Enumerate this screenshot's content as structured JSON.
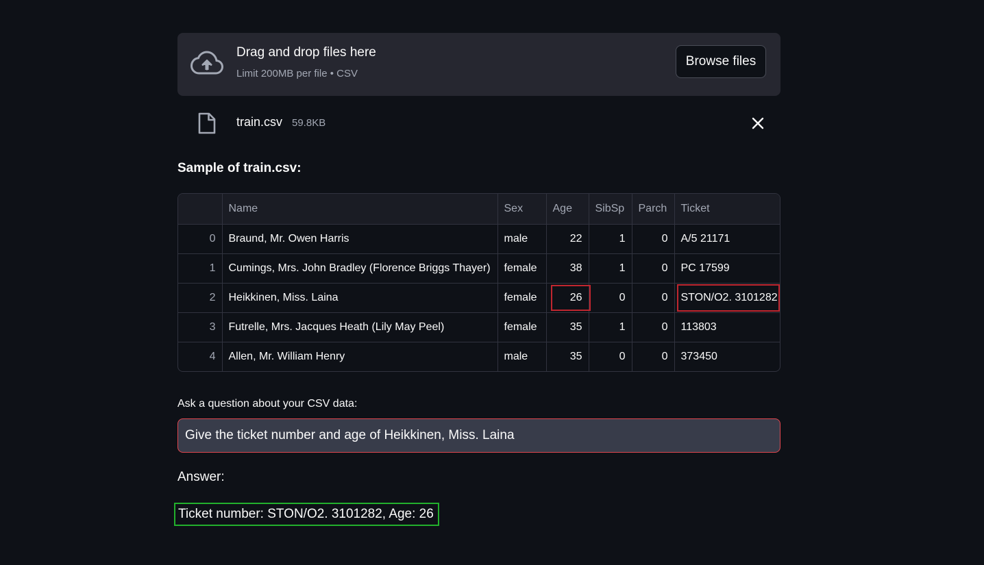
{
  "uploader": {
    "title": "Drag and drop files here",
    "subtitle": "Limit 200MB per file • CSV",
    "browse_label": "Browse files",
    "icon": "cloud-upload-icon"
  },
  "file": {
    "name": "train.csv",
    "size": "59.8KB",
    "icon": "file-icon",
    "remove_icon": "close-icon"
  },
  "sample": {
    "heading": "Sample of train.csv:",
    "columns": [
      "",
      "Name",
      "Sex",
      "Age",
      "SibSp",
      "Parch",
      "Ticket"
    ],
    "rows": [
      [
        "0",
        "Braund, Mr. Owen Harris",
        "male",
        "22",
        "1",
        "0",
        "A/5 21171"
      ],
      [
        "1",
        "Cumings, Mrs. John Bradley (Florence Briggs Thayer)",
        "female",
        "38",
        "1",
        "0",
        "PC 17599"
      ],
      [
        "2",
        "Heikkinen, Miss. Laina",
        "female",
        "26",
        "0",
        "0",
        "STON/O2. 3101282"
      ],
      [
        "3",
        "Futrelle, Mrs. Jacques Heath (Lily May Peel)",
        "female",
        "35",
        "1",
        "0",
        "113803"
      ],
      [
        "4",
        "Allen, Mr. William Henry",
        "male",
        "35",
        "0",
        "0",
        "373450"
      ]
    ]
  },
  "question": {
    "label": "Ask a question about your CSV data:",
    "value": "Give the ticket number and age of Heikkinen, Miss. Laina"
  },
  "answer": {
    "label": "Answer:",
    "text": "Ticket number: STON/O2. 3101282, Age: 26"
  },
  "colors": {
    "background": "#0e1117",
    "highlight_red": "#c0262f",
    "highlight_green": "#22b02c"
  }
}
